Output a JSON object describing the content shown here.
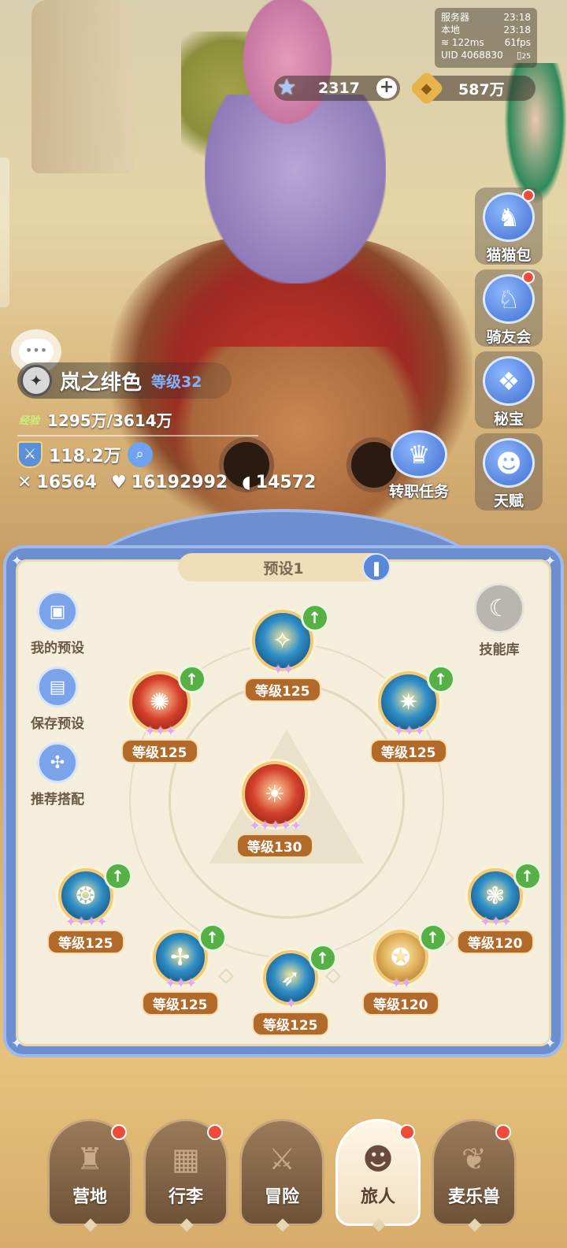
{
  "status": {
    "server_label": "服务器",
    "server_time": "23:18",
    "local_label": "本地",
    "local_time": "23:18",
    "ping": "122ms",
    "fps": "61fps",
    "uid": "UID 4068830",
    "battery": "25"
  },
  "currency": {
    "stars": "2317",
    "gold": "587万"
  },
  "side_menu": [
    {
      "label": "猫猫包",
      "icon": "cat-bag-icon",
      "badge": true
    },
    {
      "label": "骑友会",
      "icon": "horse-icon",
      "badge": true
    },
    {
      "label": "秘宝",
      "icon": "treasure-icon",
      "badge": false
    },
    {
      "label": "天赋",
      "icon": "talent-head-icon",
      "badge": false
    }
  ],
  "job_quest": {
    "label": "转职任务",
    "icon": "job-crown-icon"
  },
  "player": {
    "name": "岚之绯色",
    "level": "等级32",
    "exp_tag": "经验",
    "exp": "1295万/3614万",
    "power": "118.2万",
    "attack": "16564",
    "hp": "16192992",
    "defense": "14572"
  },
  "panel": {
    "preset_title": "预设1",
    "my_preset": "我的预设",
    "save_preset": "保存预设",
    "recommend": "推荐搭配",
    "skill_library": "技能库"
  },
  "skills": [
    {
      "level": "等级125",
      "stars": "✦✦",
      "upgrade": true,
      "theme": "blue"
    },
    {
      "level": "等级125",
      "stars": "✦✦✦",
      "upgrade": true,
      "theme": "red"
    },
    {
      "level": "等级125",
      "stars": "✦✦✦",
      "upgrade": true,
      "theme": "blue"
    },
    {
      "level": "等级130",
      "stars": "✦✦✦✦✦",
      "upgrade": false,
      "theme": "red"
    },
    {
      "level": "等级125",
      "stars": "✦✦✦✦",
      "upgrade": true,
      "theme": "blue"
    },
    {
      "level": "等级125",
      "stars": "✦✦✦",
      "upgrade": true,
      "theme": "blue"
    },
    {
      "level": "等级125",
      "stars": "✦",
      "upgrade": true,
      "theme": "blue"
    },
    {
      "level": "等级120",
      "stars": "✦✦",
      "upgrade": true,
      "theme": "gold"
    },
    {
      "level": "等级120",
      "stars": "✦✦✦",
      "upgrade": true,
      "theme": "blue"
    }
  ],
  "nav": [
    {
      "label": "营地",
      "icon": "castle-icon",
      "badge": true,
      "active": false
    },
    {
      "label": "行李",
      "icon": "backpack-icon",
      "badge": true,
      "active": false
    },
    {
      "label": "冒险",
      "icon": "crossed-swords-icon",
      "badge": false,
      "active": false
    },
    {
      "label": "旅人",
      "icon": "traveler-icon",
      "badge": true,
      "active": true
    },
    {
      "label": "麦乐兽",
      "icon": "cat-face-icon",
      "badge": true,
      "active": false
    }
  ],
  "colors": {
    "accent_blue": "#6d8fd0",
    "level_badge": "#b26a2a",
    "upgrade_green": "#56b046",
    "badge_red": "#ef4b3a"
  }
}
